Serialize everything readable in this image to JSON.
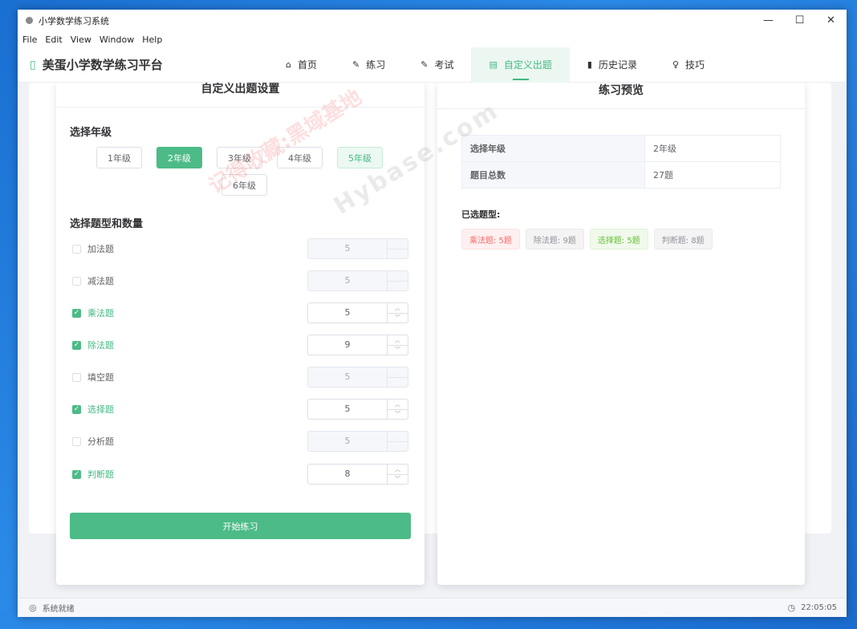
{
  "window": {
    "title": "小学数学练习系统",
    "minimize": "—",
    "maximize": "☐",
    "close": "✕"
  },
  "menu": [
    "File",
    "Edit",
    "View",
    "Window",
    "Help"
  ],
  "brand": {
    "title": "美蛋小学数学练习平台"
  },
  "nav": [
    {
      "label": "首页",
      "icon": "⌂"
    },
    {
      "label": "练习",
      "icon": "✎"
    },
    {
      "label": "考试",
      "icon": "✎"
    },
    {
      "label": "自定义出题",
      "icon": "▤",
      "active": true
    },
    {
      "label": "历史记录",
      "icon": "▮"
    },
    {
      "label": "技巧",
      "icon": "♀"
    }
  ],
  "left_panel": {
    "title": "自定义出题设置",
    "grade_section": "选择年级",
    "grades": [
      "1年级",
      "2年级",
      "3年级",
      "4年级",
      "5年级",
      "6年级"
    ],
    "selected_grade": "2年级",
    "question_section": "选择题型和数量",
    "questions": [
      {
        "label": "加法题",
        "checked": false,
        "count": "5"
      },
      {
        "label": "减法题",
        "checked": false,
        "count": "5"
      },
      {
        "label": "乘法题",
        "checked": true,
        "count": "5"
      },
      {
        "label": "除法题",
        "checked": true,
        "count": "9"
      },
      {
        "label": "填空题",
        "checked": false,
        "count": "5"
      },
      {
        "label": "选择题",
        "checked": true,
        "count": "5"
      },
      {
        "label": "分析题",
        "checked": false,
        "count": "5"
      },
      {
        "label": "判断题",
        "checked": true,
        "count": "8"
      }
    ],
    "start_button": "开始练习"
  },
  "right_panel": {
    "title": "练习预览",
    "table": [
      {
        "key": "选择年级",
        "value": "2年级"
      },
      {
        "key": "题目总数",
        "value": "27题"
      }
    ],
    "selected_types_title": "已选题型:",
    "tags": [
      {
        "label": "乘法题: 5题",
        "color": "#f56c6c"
      },
      {
        "label": "除法题: 9题",
        "color": "#909399"
      },
      {
        "label": "选择题: 5题",
        "color": "#67c23a"
      },
      {
        "label": "判断题: 8题",
        "color": "#909399"
      }
    ]
  },
  "status": {
    "text": "系统就绪",
    "time": "22:05:05"
  },
  "watermark": {
    "text1": "记得收藏:黑域基地",
    "text2": "Hybase.com"
  },
  "colors": {
    "accent": "#4cbb87",
    "accent_text": "#42b983"
  }
}
